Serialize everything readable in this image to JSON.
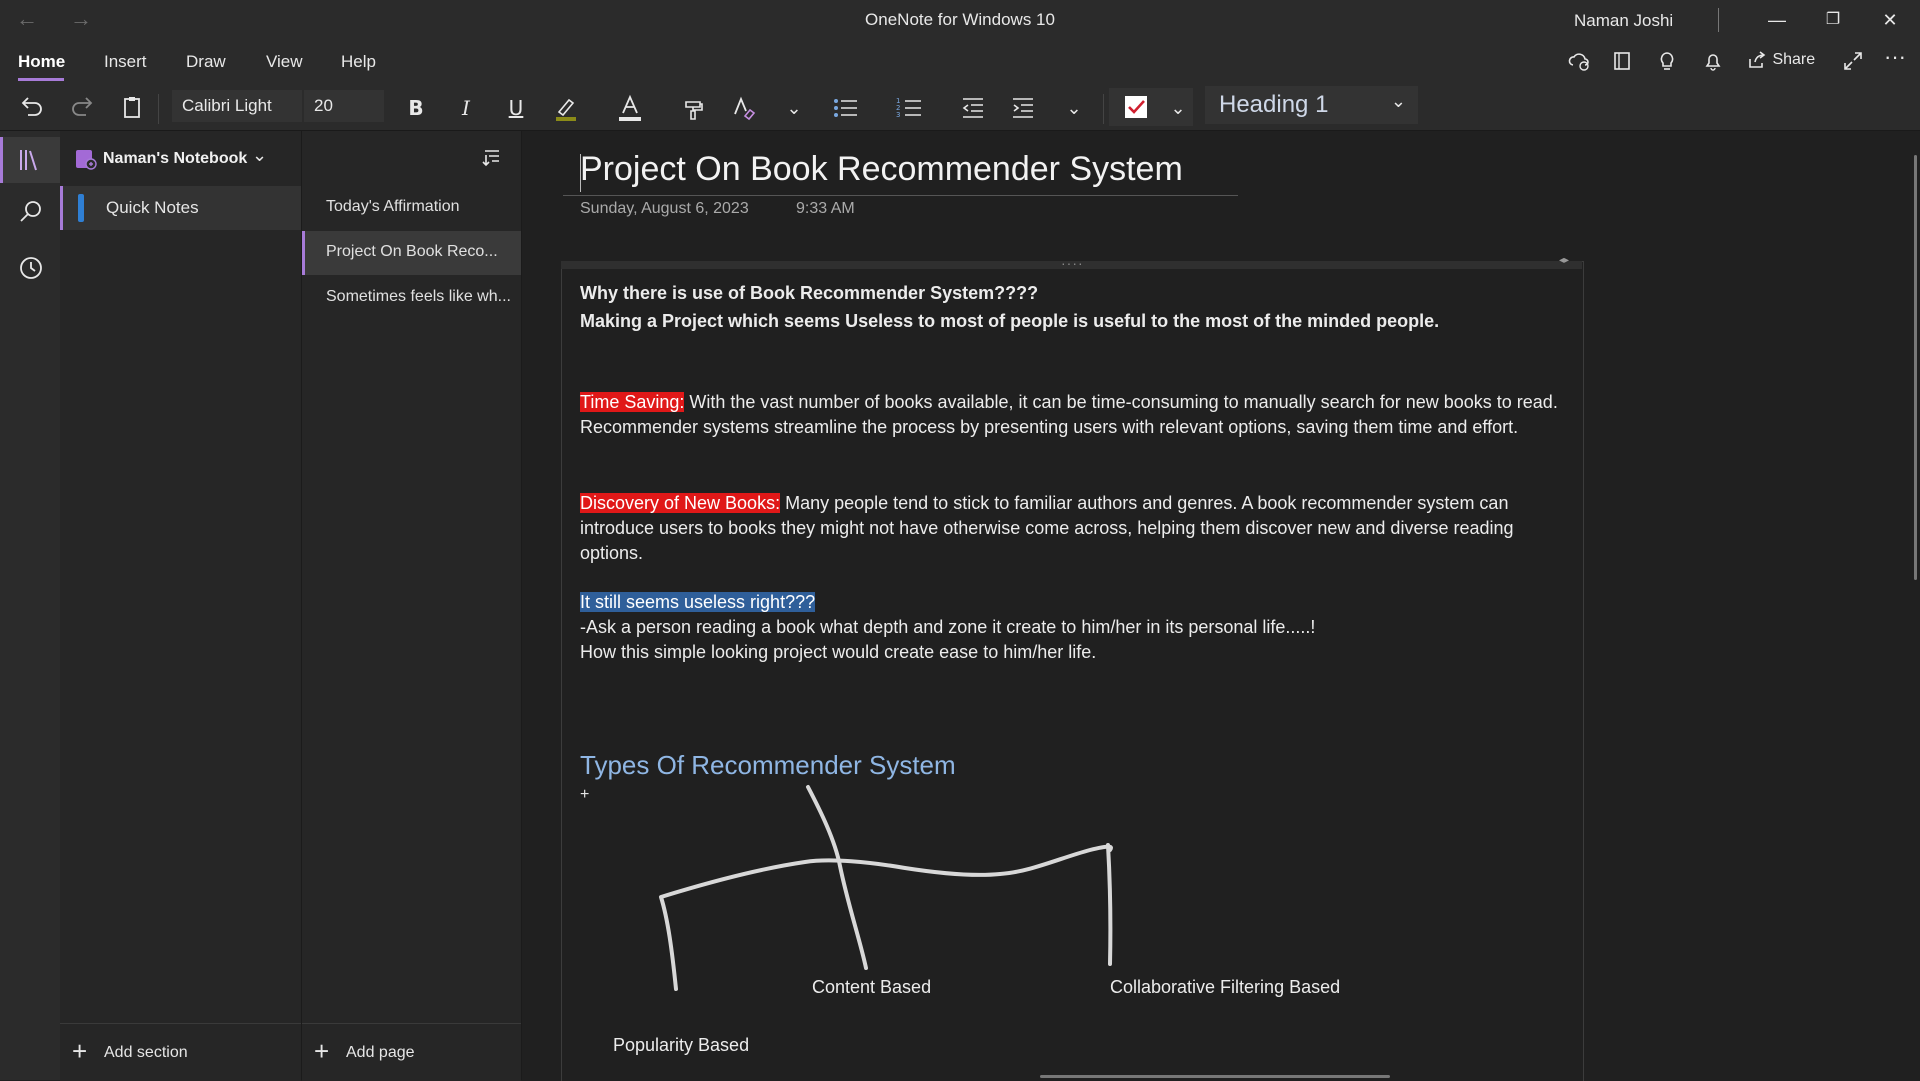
{
  "window": {
    "title": "OneNote for Windows 10",
    "user": "Naman Joshi",
    "back_glyph": "←",
    "forward_glyph": "→",
    "minimize_glyph": "—",
    "restore_glyph": "❐",
    "close_glyph": "✕"
  },
  "menu": {
    "tabs": [
      "Home",
      "Insert",
      "Draw",
      "View",
      "Help"
    ],
    "active": "Home",
    "share_label": "Share",
    "more_glyph": "···"
  },
  "toolbar": {
    "font_name": "Calibri Light",
    "font_size": "20",
    "bold_glyph": "B",
    "italic_glyph": "I",
    "underline_glyph": "U",
    "style": "Heading 1",
    "chevron_glyph": "⌄"
  },
  "notebook": {
    "name": "Naman's Notebook",
    "sections": [
      "Quick Notes"
    ],
    "pages": [
      "Today's Affirmation",
      "Project On Book Reco...",
      "Sometimes feels like wh..."
    ],
    "selected_page": 1,
    "add_section_label": "Add section",
    "add_page_label": "Add page",
    "plus_glyph": "+"
  },
  "page": {
    "title": "Project On Book Recommender System",
    "date": "Sunday, August 6, 2023",
    "time": "9:33 AM",
    "line1": "Why there is use of Book Recommender System????",
    "line2": "Making a Project which seems Useless to most of people is useful to the most of the minded people.",
    "p1_label": "Time Saving:",
    "p1_text": " With the vast number of books available, it can be time-consuming to manually search for new books to read. Recommender systems streamline the process by presenting users with relevant options, saving them time and effort.",
    "p2_label": "Discovery of New Books:",
    "p2_text": " Many people tend to stick to familiar authors and genres. A book recommender system can introduce users to books they might not have otherwise come across, helping them discover new and diverse reading options.",
    "q_label": "It still seems useless right???",
    "q_line1": "-Ask a person reading a book what depth and zone it create to him/her in its personal life.....!",
    "q_line2": "How this simple looking project would create ease to him/her life.",
    "types_heading": "Types Of Recommender System",
    "plus_mark": "+",
    "types": [
      "Popularity Based",
      "Content Based",
      "Collaborative Filtering Based"
    ]
  },
  "colors": {
    "accent": "#a77bd8",
    "highlight_red": "#e01818",
    "highlight_blue": "#2f5f9a",
    "heading_blue": "#8fb6e4",
    "section_blue": "#2f7fd4"
  }
}
